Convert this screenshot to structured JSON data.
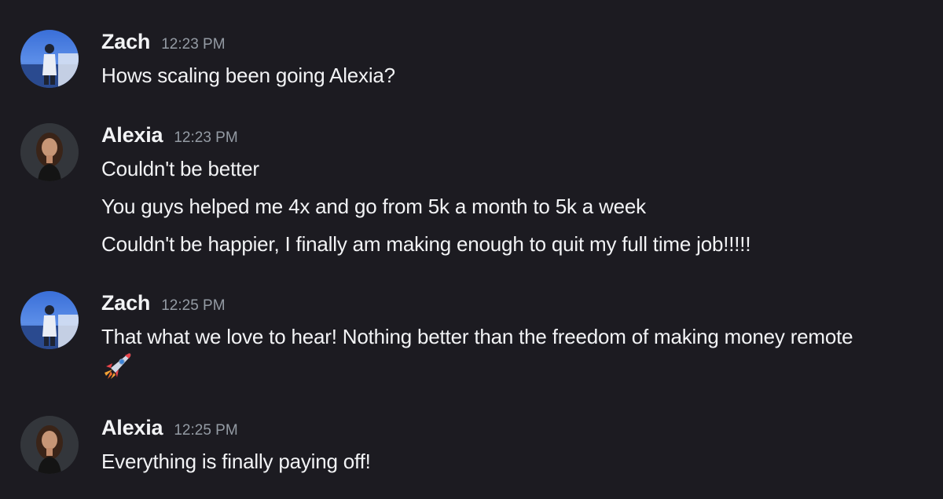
{
  "messages": [
    {
      "author": "Zach",
      "time": "12:23 PM",
      "avatar_icon": "zach-avatar",
      "lines": [
        "Hows scaling been going Alexia?"
      ]
    },
    {
      "author": "Alexia",
      "time": "12:23 PM",
      "avatar_icon": "alexia-avatar",
      "lines": [
        "Couldn't be better",
        "You guys helped me 4x and go from 5k a month to 5k a week",
        "Couldn't be happier, I finally am making enough to quit my full time job!!!!!"
      ]
    },
    {
      "author": "Zach",
      "time": "12:25 PM",
      "avatar_icon": "zach-avatar",
      "lines": [
        "That what we love to hear! Nothing better than the freedom of making money remote"
      ],
      "emoji": "rocket-emoji"
    },
    {
      "author": "Alexia",
      "time": "12:25 PM",
      "avatar_icon": "alexia-avatar",
      "lines": [
        "Everything is finally paying off!"
      ]
    }
  ],
  "colors": {
    "background": "#1c1b21",
    "text": "#f2f3f5",
    "timestamp": "#949ba4"
  }
}
